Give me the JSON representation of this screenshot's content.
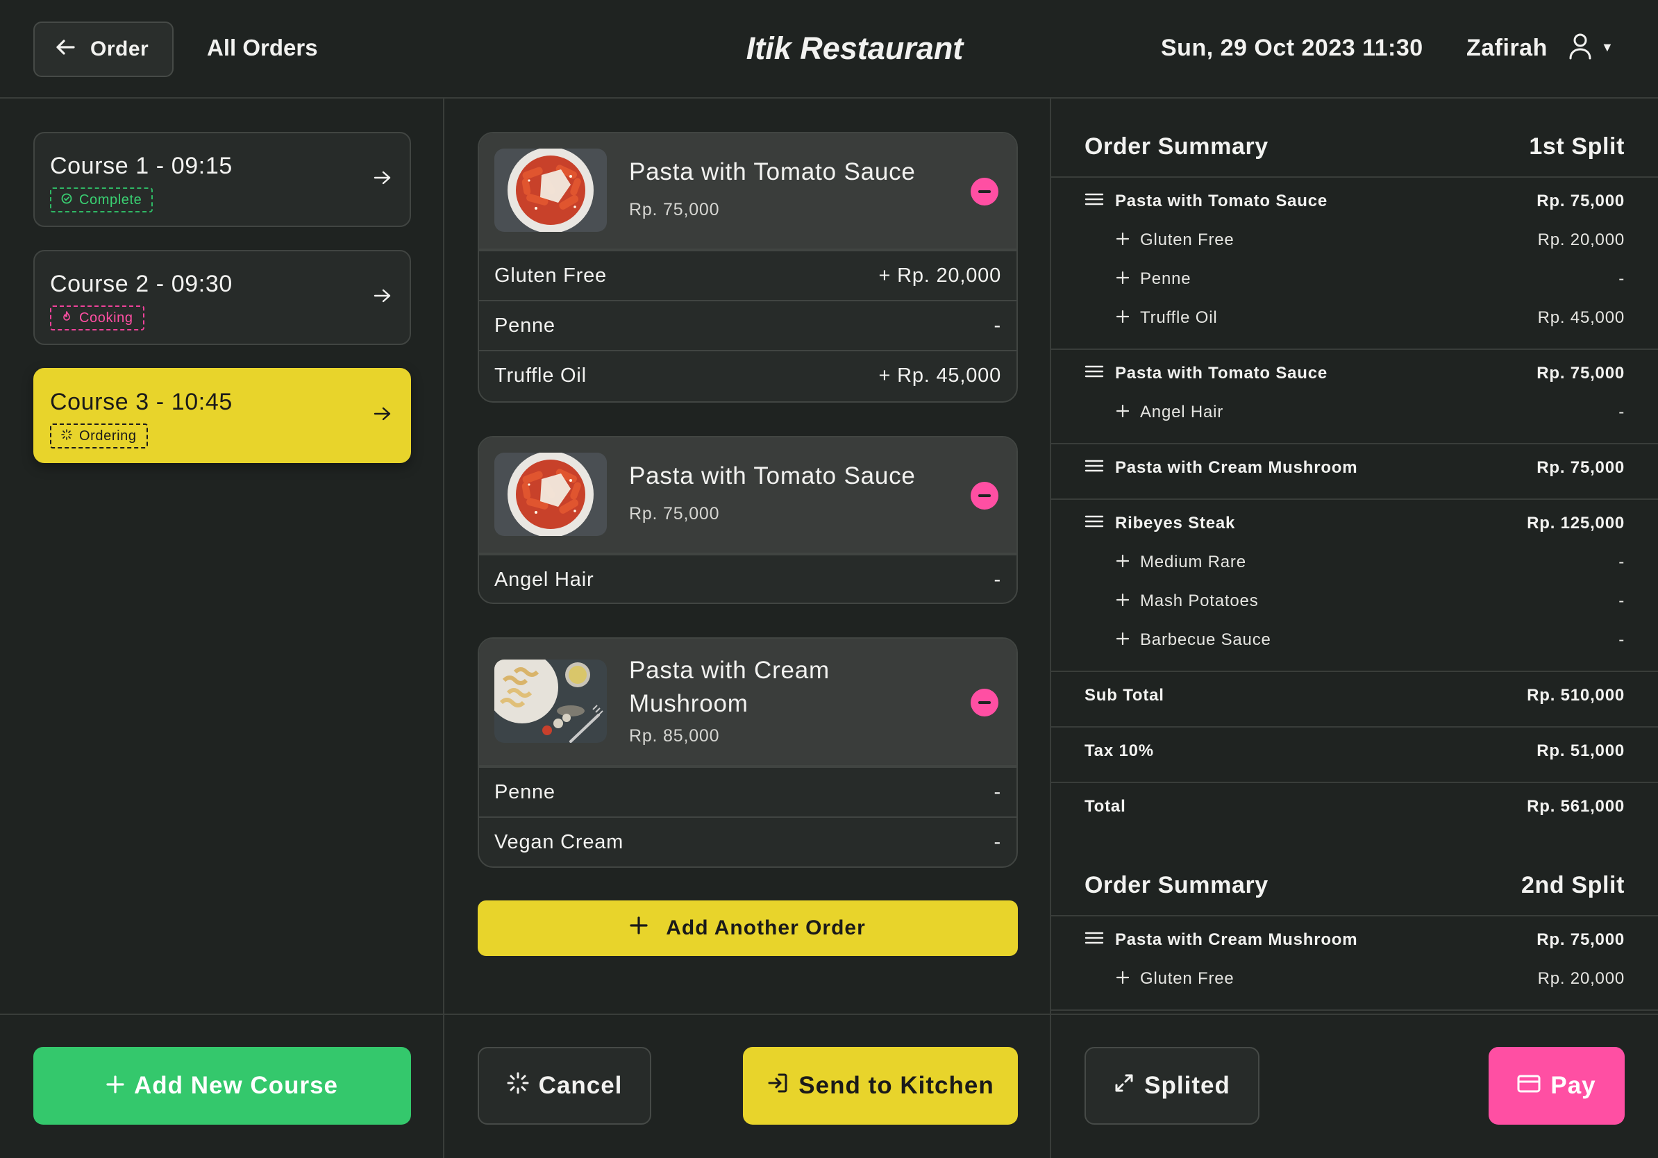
{
  "header": {
    "back_label": "Order",
    "all_orders_label": "All Orders",
    "title": "Itik Restaurant",
    "datetime": "Sun, 29 Oct 2023 11:30",
    "user_name": "Zafirah"
  },
  "courses": [
    {
      "title": "Course 1 - 09:15",
      "status": "Complete",
      "status_color": "#3ad072"
    },
    {
      "title": "Course 2 - 09:30",
      "status": "Cooking",
      "status_color": "#ff4fa3"
    },
    {
      "title": "Course 3 - 10:45",
      "status": "Ordering",
      "status_color": "#1a1a1a",
      "active": true
    }
  ],
  "orders": [
    {
      "name": "Pasta with Tomato Sauce",
      "price": "Rp. 75,000",
      "options": [
        {
          "label": "Gluten Free",
          "value": "+ Rp. 20,000"
        },
        {
          "label": "Penne",
          "value": "-"
        },
        {
          "label": "Truffle Oil",
          "value": "+ Rp. 45,000"
        }
      ]
    },
    {
      "name": "Pasta with Tomato Sauce",
      "price": "Rp. 75,000",
      "options": [
        {
          "label": "Angel Hair",
          "value": "-"
        }
      ]
    },
    {
      "name_line1": "Pasta with Cream",
      "name_line2": "Mushroom",
      "price": "Rp. 85,000",
      "options": [
        {
          "label": "Penne",
          "value": "-"
        },
        {
          "label": "Vegan Cream",
          "value": "-"
        }
      ]
    }
  ],
  "add_order_label": "Add Another Order",
  "summary": {
    "split1": {
      "title": "Order Summary",
      "split_label": "1st Split",
      "items": [
        {
          "name": "Pasta with Tomato Sauce",
          "price": "Rp. 75,000",
          "addons": [
            {
              "name": "Gluten Free",
              "price": "Rp. 20,000"
            },
            {
              "name": "Penne",
              "price": "-"
            },
            {
              "name": "Truffle Oil",
              "price": "Rp. 45,000"
            }
          ]
        },
        {
          "name": "Pasta with Tomato Sauce",
          "price": "Rp. 75,000",
          "addons": [
            {
              "name": "Angel Hair",
              "price": "-"
            }
          ]
        },
        {
          "name": "Pasta with Cream Mushroom",
          "price": "Rp. 75,000",
          "addons": []
        },
        {
          "name": "Ribeyes Steak",
          "price": "Rp. 125,000",
          "addons": [
            {
              "name": "Medium Rare",
              "price": "-"
            },
            {
              "name": "Mash Potatoes",
              "price": "-"
            },
            {
              "name": "Barbecue Sauce",
              "price": "-"
            }
          ]
        }
      ],
      "subtotal_label": "Sub Total",
      "subtotal": "Rp. 510,000",
      "tax_label": "Tax 10%",
      "tax": "Rp. 51,000",
      "total_label": "Total",
      "total": "Rp. 561,000"
    },
    "split2": {
      "title": "Order Summary",
      "split_label": "2nd Split",
      "items": [
        {
          "name": "Pasta with Cream Mushroom",
          "price": "Rp. 75,000",
          "addons": [
            {
              "name": "Gluten Free",
              "price": "Rp. 20,000"
            }
          ]
        }
      ]
    }
  },
  "actions": {
    "add_course": "Add New Course",
    "cancel": "Cancel",
    "send_kitchen": "Send to Kitchen",
    "splited": "Splited",
    "pay": "Pay"
  },
  "colors": {
    "accent_yellow": "#e8d42b",
    "accent_green": "#34c86c",
    "accent_pink": "#ff4fa3",
    "background": "#1f2321"
  }
}
